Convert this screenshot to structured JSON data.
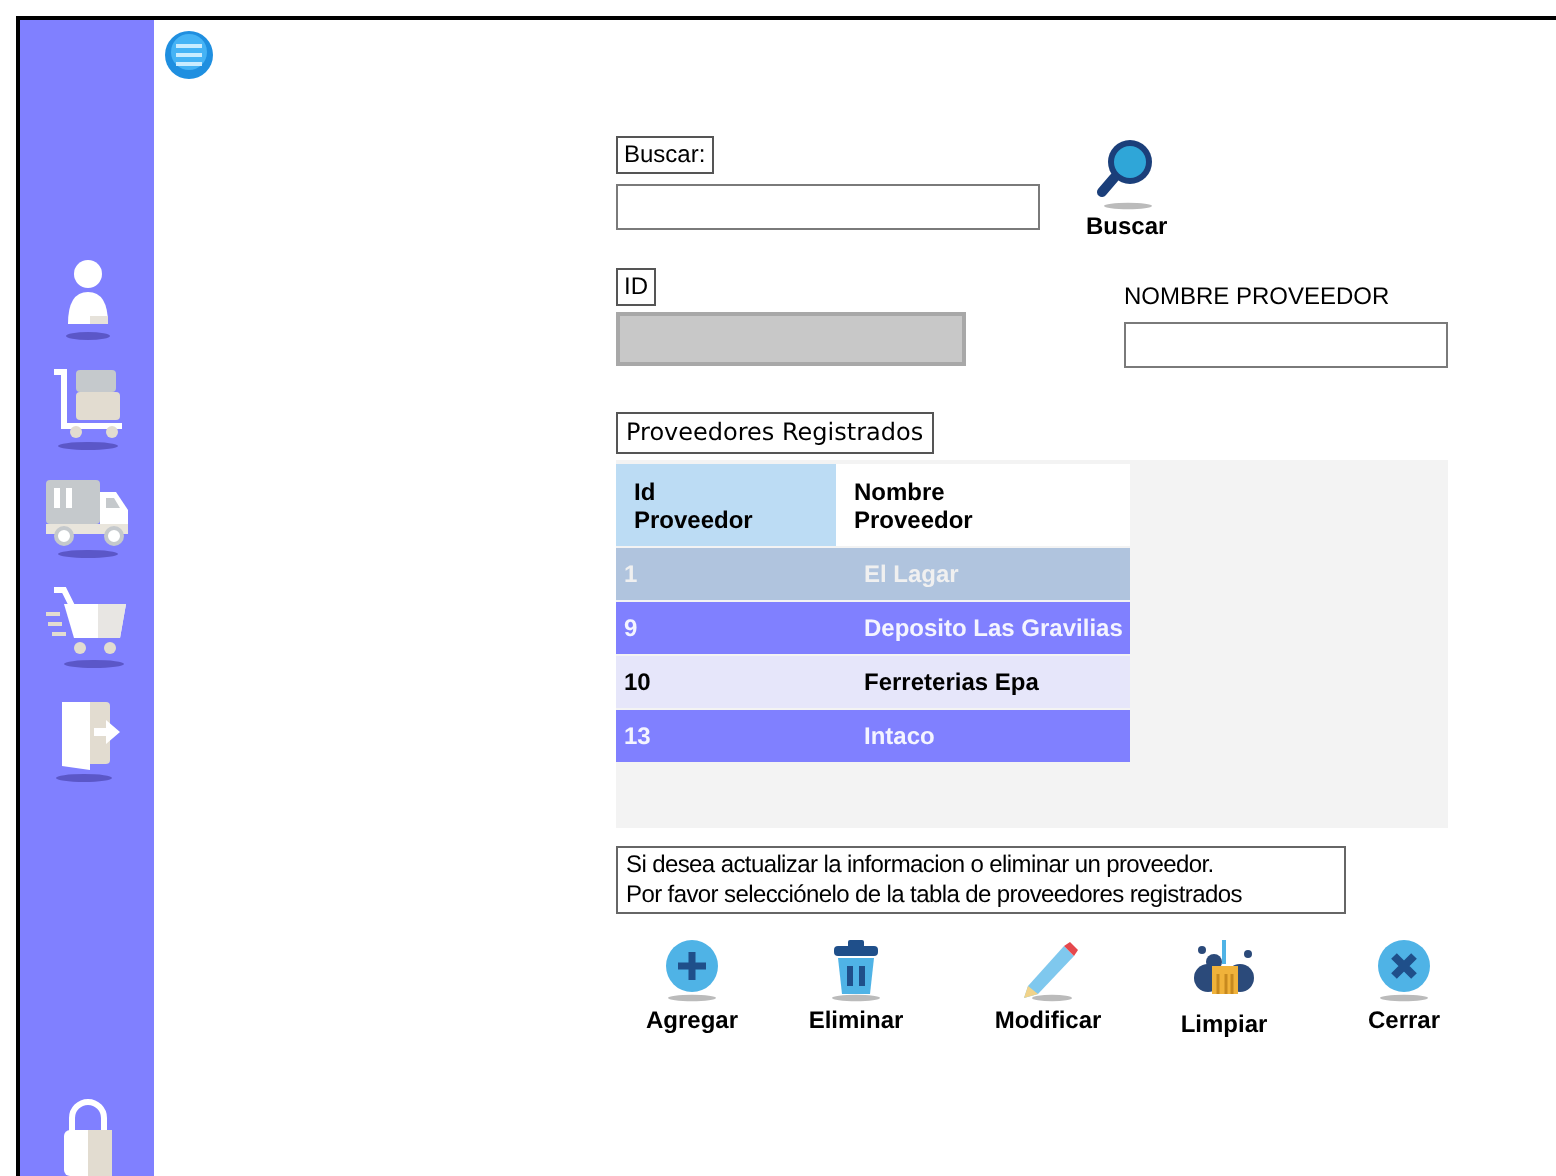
{
  "sidebar": {
    "items": [
      {
        "kind": "user"
      },
      {
        "kind": "dolly"
      },
      {
        "kind": "truck"
      },
      {
        "kind": "cart"
      },
      {
        "kind": "exit"
      },
      {
        "kind": "lock"
      }
    ]
  },
  "search": {
    "label": "Buscar:",
    "button": "Buscar"
  },
  "id_field": {
    "label": "ID",
    "disabled": true
  },
  "name_field": {
    "label": "NOMBRE PROVEEDOR"
  },
  "table": {
    "title": "Proveedores Registrados",
    "columns": [
      {
        "label": "Id Proveedor",
        "selected": true
      },
      {
        "label": "Nombre Proveedor",
        "selected": false
      }
    ],
    "rows": [
      {
        "cells": [
          "1",
          "El Lagar"
        ],
        "selected": true
      },
      {
        "cells": [
          "9",
          "Deposito Las Gravilias"
        ],
        "selected": false
      },
      {
        "cells": [
          "10",
          "Ferreterias Epa"
        ],
        "selected": false
      },
      {
        "cells": [
          "13",
          "Intaco"
        ],
        "selected": false
      }
    ]
  },
  "note": {
    "lines": [
      "Si desea actualizar la informacion o eliminar un proveedor.",
      "Por favor selecciónelo de la tabla de proveedores registrados"
    ]
  },
  "actions": [
    {
      "label": "Agregar",
      "kind": "add"
    },
    {
      "label": "Eliminar",
      "kind": "delete"
    },
    {
      "label": "Modificar",
      "kind": "edit"
    },
    {
      "label": "Limpiar",
      "kind": "clear"
    },
    {
      "label": "Cerrar",
      "kind": "close"
    }
  ]
}
